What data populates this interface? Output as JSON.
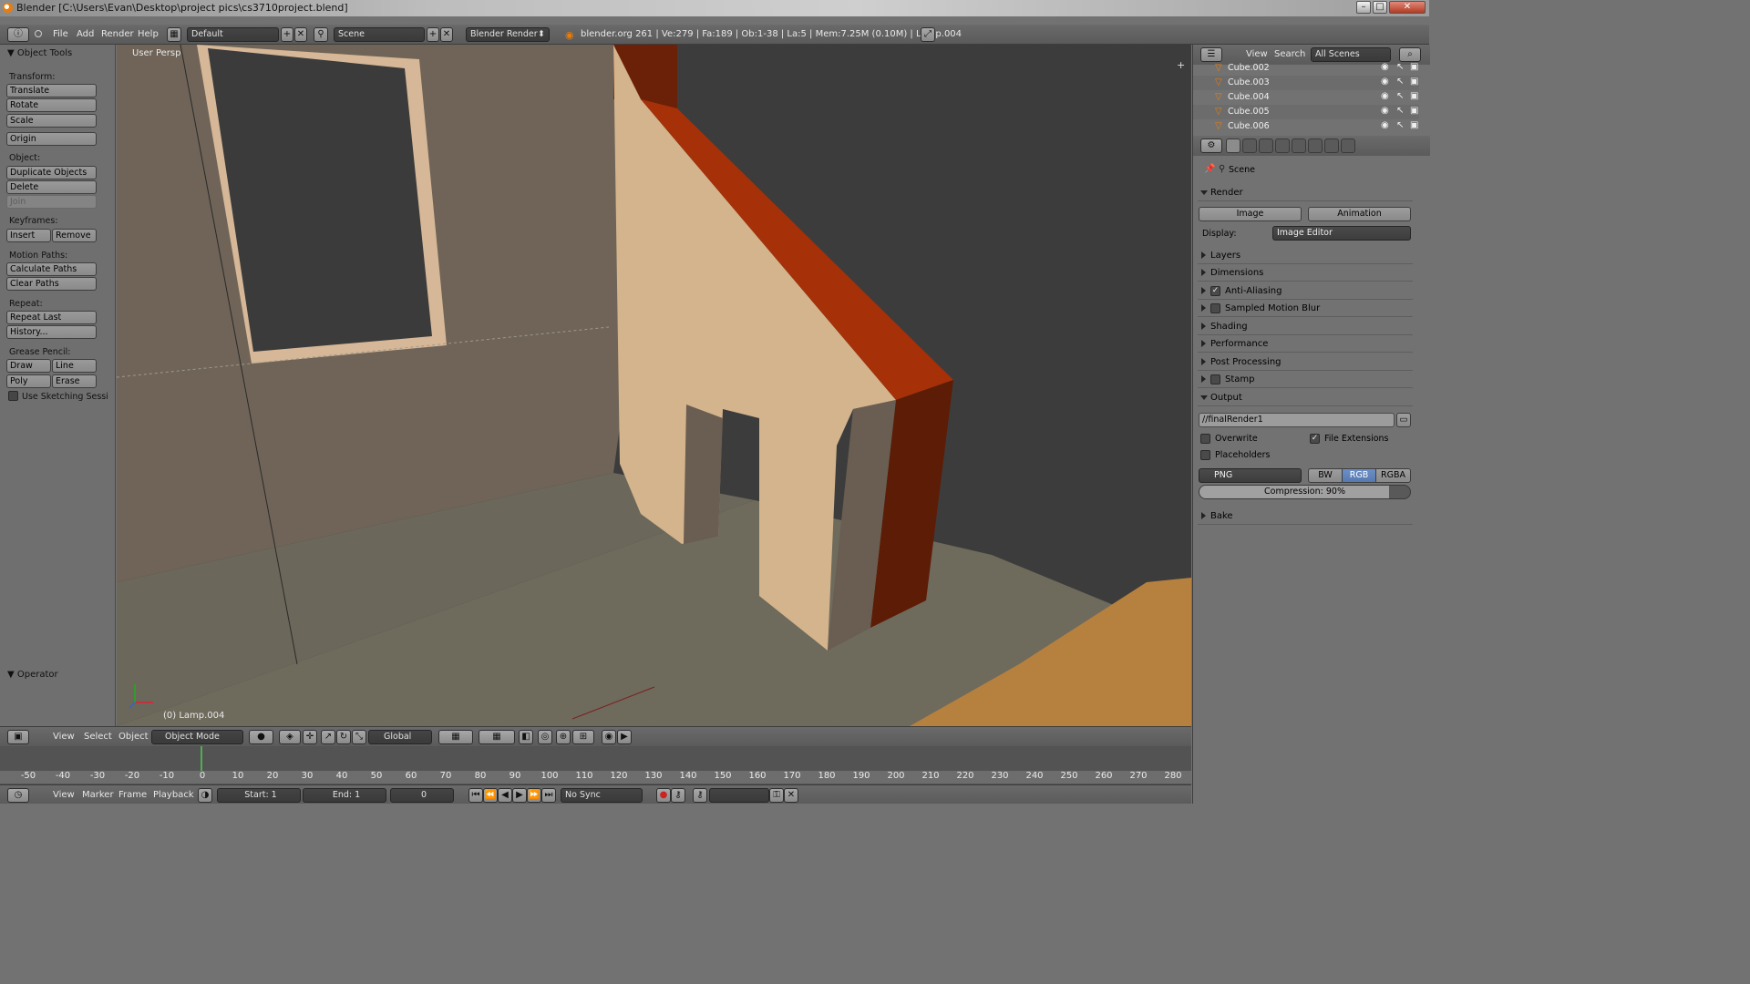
{
  "window": {
    "title": "Blender [C:\\Users\\Evan\\Desktop\\project pics\\cs3710project.blend]"
  },
  "info_header": {
    "menus": [
      "File",
      "Add",
      "Render",
      "Help"
    ],
    "layout": "Default",
    "scene": "Scene",
    "engine": "Blender Render",
    "stats": "blender.org 261 | Ve:279 | Fa:189 | Ob:1-38 | La:5 | Mem:7.25M (0.10M) | Lamp.004"
  },
  "tool_shelf": {
    "title": "Object Tools",
    "transform_label": "Transform:",
    "translate": "Translate",
    "rotate": "Rotate",
    "scale": "Scale",
    "origin": "Origin",
    "object_label": "Object:",
    "duplicate": "Duplicate Objects",
    "delete": "Delete",
    "join": "Join",
    "keyframes_label": "Keyframes:",
    "insert": "Insert",
    "remove": "Remove",
    "motion_label": "Motion Paths:",
    "calc_paths": "Calculate Paths",
    "clear_paths": "Clear Paths",
    "repeat_label": "Repeat:",
    "repeat_last": "Repeat Last",
    "history": "History...",
    "grease_label": "Grease Pencil:",
    "draw": "Draw",
    "line": "Line",
    "poly": "Poly",
    "erase": "Erase",
    "sketching": "Use Sketching Sessi",
    "operator": "Operator"
  },
  "viewport": {
    "persp_label": "User Persp",
    "object_label": "(0) Lamp.004"
  },
  "view3d_header": {
    "menus": [
      "View",
      "Select",
      "Object"
    ],
    "mode": "Object Mode",
    "orientation": "Global"
  },
  "timeline": {
    "ticks": [
      "-50",
      "-40",
      "-30",
      "-20",
      "-10",
      "0",
      "10",
      "20",
      "30",
      "40",
      "50",
      "60",
      "70",
      "80",
      "90",
      "100",
      "110",
      "120",
      "130",
      "140",
      "150",
      "160",
      "170",
      "180",
      "190",
      "200",
      "210",
      "220",
      "230",
      "240",
      "250",
      "260",
      "270",
      "280"
    ],
    "menus": [
      "View",
      "Marker",
      "Frame",
      "Playback"
    ],
    "start": "Start: 1",
    "end": "End: 1",
    "current": "0",
    "sync": "No Sync"
  },
  "outliner": {
    "view": "View",
    "search": "Search",
    "filter": "All Scenes",
    "items": [
      "Cube.002",
      "Cube.003",
      "Cube.004",
      "Cube.005",
      "Cube.006"
    ]
  },
  "properties": {
    "scene": "Scene",
    "render_panel": "Render",
    "image_btn": "Image",
    "animation_btn": "Animation",
    "display_label": "Display:",
    "display_value": "Image Editor",
    "panels": [
      "Layers",
      "Dimensions",
      "Anti-Aliasing",
      "Sampled Motion Blur",
      "Shading",
      "Performance",
      "Post Processing",
      "Stamp"
    ],
    "output_panel": "Output",
    "output_path": "//finalRender1",
    "overwrite": "Overwrite",
    "file_ext": "File Extensions",
    "placeholders": "Placeholders",
    "format": "PNG",
    "bw": "BW",
    "rgb": "RGB",
    "rgba": "RGBA",
    "compression": "Compression: 90%",
    "compression_value": 0.9,
    "bake": "Bake"
  }
}
